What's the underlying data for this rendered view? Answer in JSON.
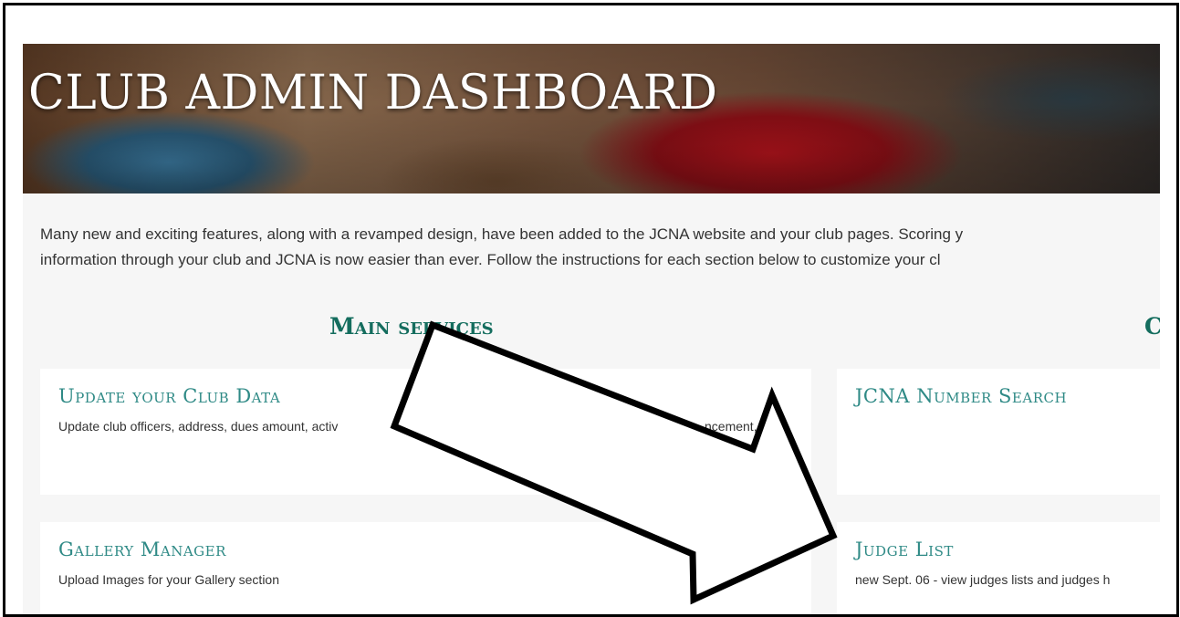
{
  "header": {
    "title": "CLUB ADMIN DASHBOARD"
  },
  "intro": {
    "line1": "Many new and exciting features, along with a revamped design, have been added to the JCNA website and your club pages. Scoring y",
    "line2": "information through your club and JCNA is now easier than ever. Follow the instructions for each section below to customize your cl"
  },
  "sections": {
    "main_title": "Main services",
    "second_title": "C"
  },
  "cards": {
    "update_club_data": {
      "title": "Update your Club Data",
      "desc": "Update club officers, address, dues amount, activ",
      "desc_tail": "ncement,"
    },
    "jcna_number_search": {
      "title": "JCNA Number Search",
      "desc": ""
    },
    "gallery_manager": {
      "title": "Gallery Manager",
      "desc": "Upload Images for your Gallery section"
    },
    "judge_list": {
      "title": "Judge List",
      "desc": "new Sept. 06 - view judges lists and judges h"
    }
  },
  "colors": {
    "accent": "#146d5e",
    "card_title": "#2f8a86",
    "arrow_fill": "#ffffff",
    "arrow_stroke": "#000000"
  },
  "annotation": {
    "icon": "arrow-annotation-icon"
  }
}
